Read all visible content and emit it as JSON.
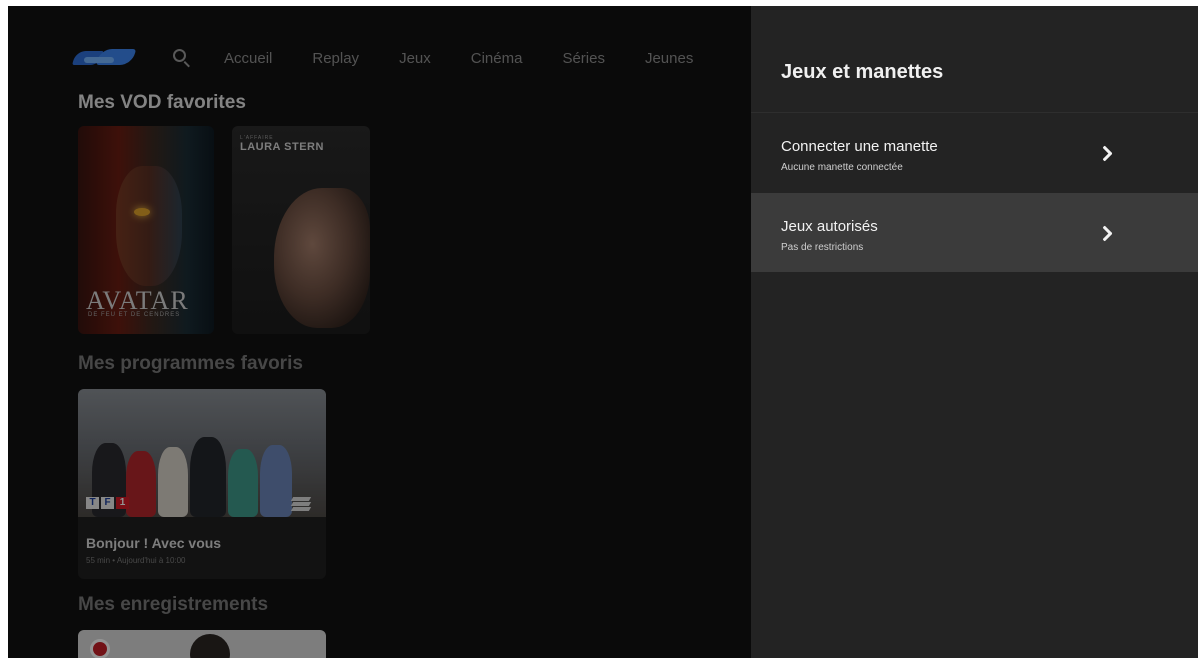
{
  "nav": {
    "items": [
      "Accueil",
      "Replay",
      "Jeux",
      "Cinéma",
      "Séries",
      "Jeunes"
    ]
  },
  "sections": {
    "vod": "Mes VOD favorites",
    "programs": "Mes programmes favoris",
    "recordings": "Mes enregistrements"
  },
  "posters": [
    {
      "title": "AVATAR",
      "subtitle": "DE FEU ET DE CENDRES"
    },
    {
      "pretitle": "L'AFFAIRE",
      "title": "LAURA STERN"
    }
  ],
  "program_card": {
    "channel_letters": [
      "T",
      "F",
      "1"
    ],
    "title": "Bonjour ! Avec vous",
    "meta": "55 min • Aujourd'hui à 10:00"
  },
  "panel": {
    "title": "Jeux et manettes",
    "items": [
      {
        "label": "Connecter une manette",
        "sub": "Aucune manette connectée",
        "selected": false
      },
      {
        "label": "Jeux autorisés",
        "sub": "Pas de restrictions",
        "selected": true
      }
    ]
  },
  "colors": {
    "panel_bg": "#232323",
    "panel_selected": "#3b3b3b",
    "screen_bg": "#141414",
    "record_red": "#c42029"
  },
  "icons": [
    "logo",
    "search-icon",
    "chevron-right-icon",
    "stack-icon",
    "record-dot-icon"
  ]
}
